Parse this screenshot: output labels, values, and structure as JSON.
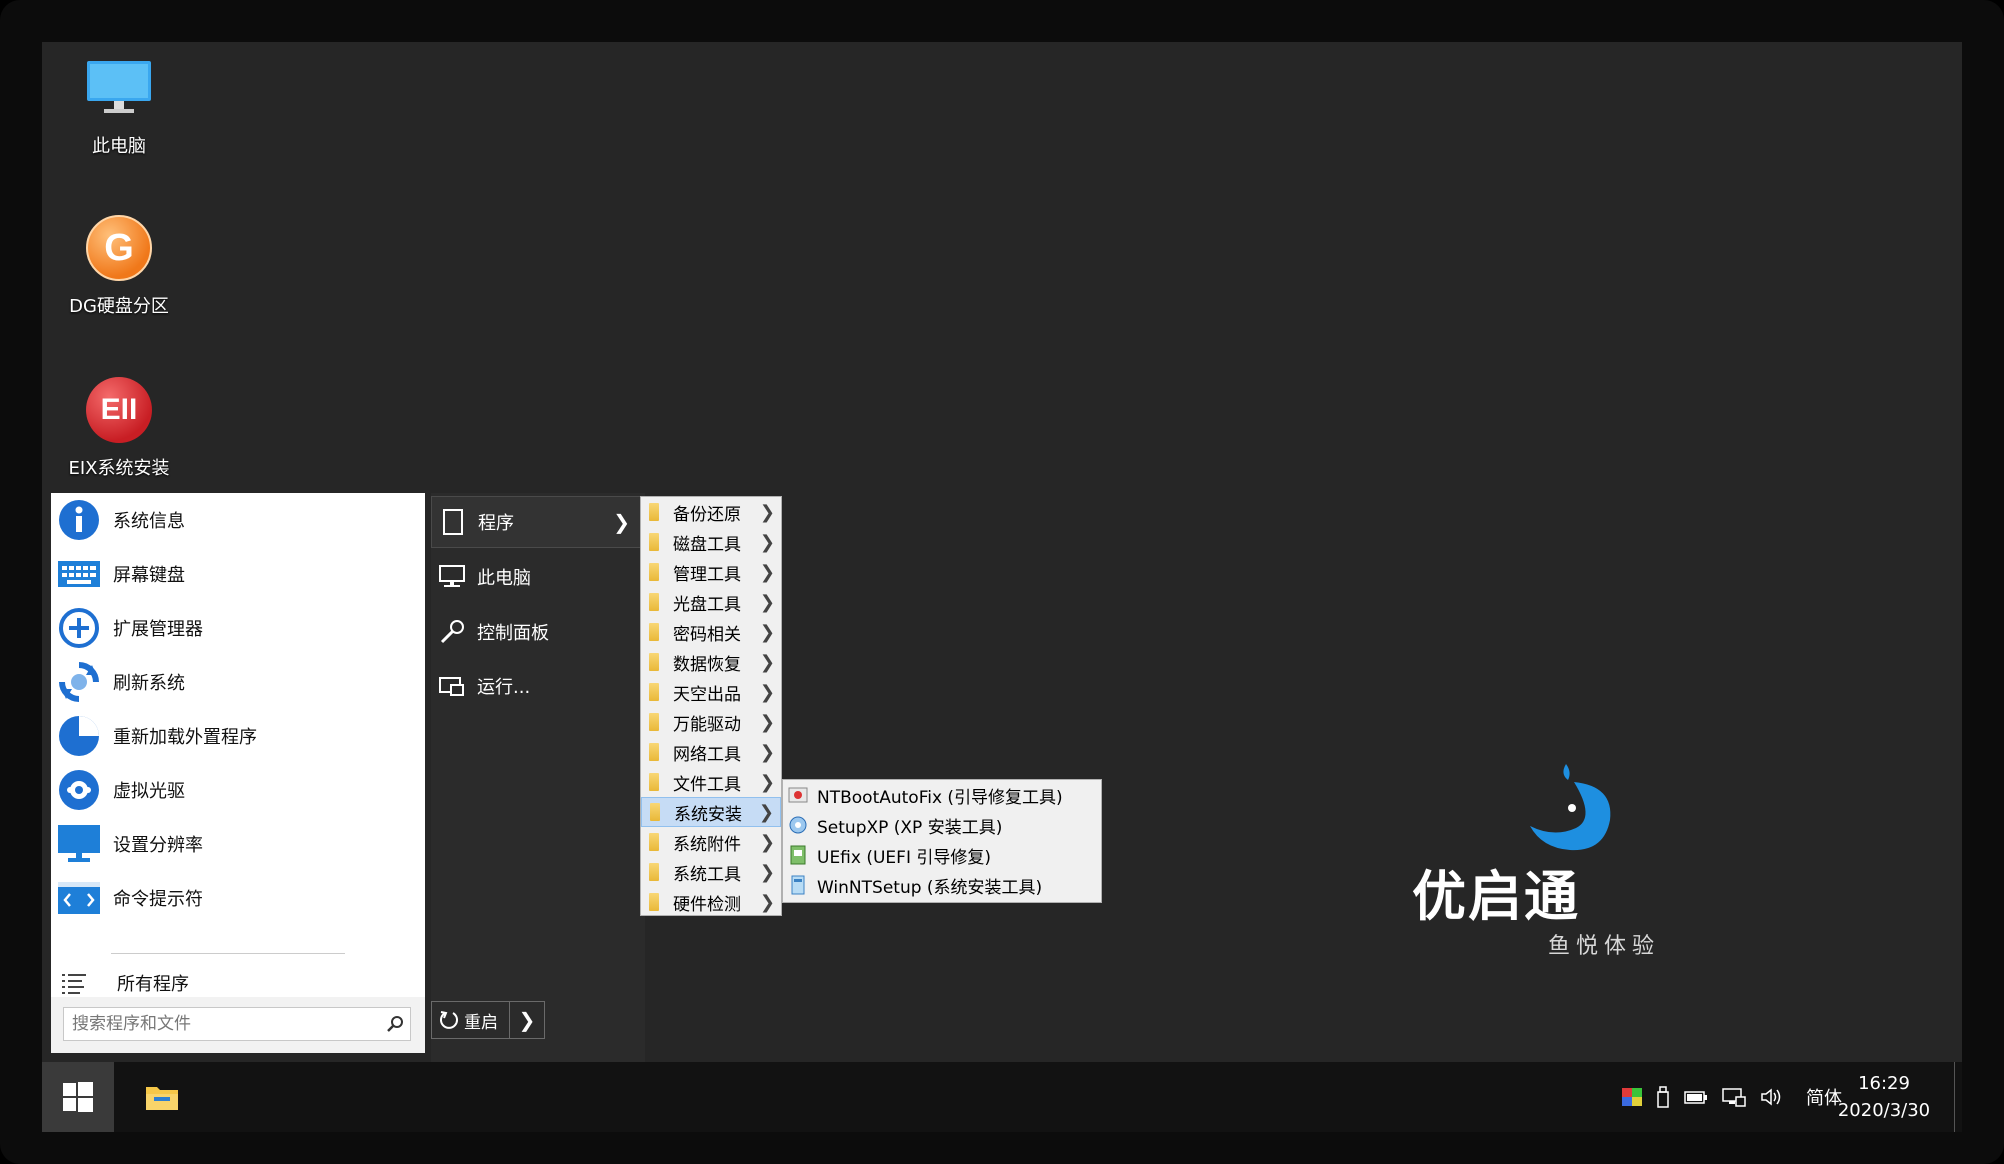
{
  "desktop": {
    "icons": [
      {
        "label": "此电脑",
        "icon": "monitor-icon"
      },
      {
        "label": "DG硬盘分区",
        "icon": "dg-partition-icon",
        "glyph": "G"
      },
      {
        "label": "EIX系统安装",
        "icon": "eix-install-icon",
        "glyph": "EII"
      }
    ]
  },
  "start_menu": {
    "left_items": [
      {
        "label": "系统信息",
        "icon": "info-icon"
      },
      {
        "label": "屏幕键盘",
        "icon": "keyboard-icon"
      },
      {
        "label": "扩展管理器",
        "icon": "plus-circle-icon"
      },
      {
        "label": "刷新系统",
        "icon": "refresh-icon"
      },
      {
        "label": "重新加载外置程序",
        "icon": "pie-chart-icon"
      },
      {
        "label": "虚拟光驱",
        "icon": "disc-icon"
      },
      {
        "label": "设置分辨率",
        "icon": "display-icon"
      },
      {
        "label": "命令提示符",
        "icon": "cmd-icon"
      }
    ],
    "all_programs": "所有程序",
    "search_placeholder": "搜索程序和文件",
    "right_items": [
      {
        "label": "程序",
        "icon": "document-icon"
      },
      {
        "label": "此电脑",
        "icon": "computer-icon"
      },
      {
        "label": "控制面板",
        "icon": "wrench-icon"
      },
      {
        "label": "运行...",
        "icon": "run-icon"
      }
    ],
    "restart_label": "重启"
  },
  "programs_submenu": {
    "items": [
      "备份还原",
      "磁盘工具",
      "管理工具",
      "光盘工具",
      "密码相关",
      "数据恢复",
      "天空出品",
      "万能驱动",
      "网络工具",
      "文件工具",
      "系统安装",
      "系统附件",
      "系统工具",
      "硬件检测"
    ],
    "active_index": 10
  },
  "install_submenu": {
    "items": [
      {
        "label": "NTBootAutoFix (引导修复工具)",
        "icon": "ntboot-icon"
      },
      {
        "label": "SetupXP (XP 安装工具)",
        "icon": "setupxp-icon"
      },
      {
        "label": "UEfix (UEFI 引导修复)",
        "icon": "uefix-icon"
      },
      {
        "label": "WinNTSetup (系统安装工具)",
        "icon": "winntsetup-icon"
      }
    ]
  },
  "brand": {
    "name": "优启通",
    "slogan": "鱼悦体验"
  },
  "taskbar": {
    "ime": "简体",
    "time": "16:29",
    "date": "2020/3/30"
  },
  "colors": {
    "desktop_bg": "#262626",
    "accent_blue": "#1e8fe0",
    "menu_highlight": "#c6dcf5"
  }
}
